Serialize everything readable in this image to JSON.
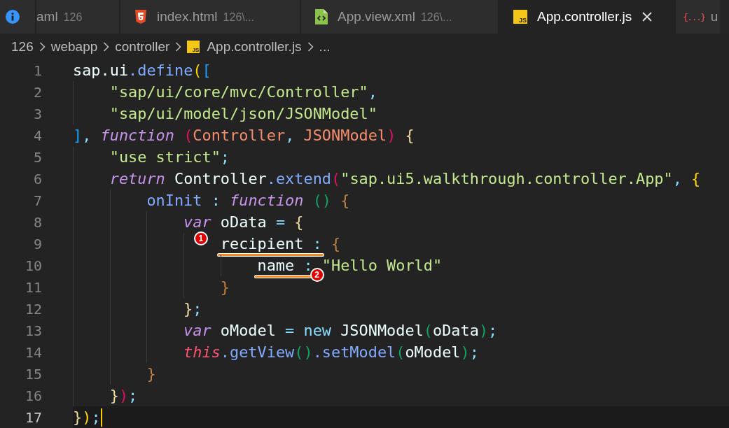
{
  "tabs": [
    {
      "kind": "info",
      "selected": false
    },
    {
      "label": "aml",
      "detail": "126",
      "selected": false
    },
    {
      "kind": "html",
      "label": "index.html",
      "detail": "126\\...",
      "selected": false
    },
    {
      "kind": "xml",
      "label": "App.view.xml",
      "detail": "126\\...",
      "selected": false
    },
    {
      "kind": "js",
      "icon_text": "JS",
      "label": "App.controller.js",
      "selected": true
    },
    {
      "kind": "json",
      "icon_text": "{...}",
      "label": "u",
      "selected": false
    }
  ],
  "breadcrumb": [
    {
      "label": "126"
    },
    {
      "label": "webapp"
    },
    {
      "label": "controller"
    },
    {
      "kind": "js",
      "icon_text": "JS",
      "label": "App.controller.js"
    },
    {
      "label": "..."
    }
  ],
  "lines": [
    {
      "number": "1",
      "current": false,
      "tokens": [
        {
          "text": "sap.ui",
          "kind": "id"
        },
        {
          "text": ".define",
          "kind": "prop"
        },
        {
          "text": "(",
          "kind": "bk-gold"
        },
        {
          "text": "[",
          "kind": "bk-blue"
        }
      ]
    },
    {
      "number": "2",
      "current": false,
      "tokens": [
        {
          "text": "    \"sap/ui/core/mvc/Controller\"",
          "kind": "str"
        },
        {
          "text": ",",
          "kind": "punct"
        }
      ]
    },
    {
      "number": "3",
      "current": false,
      "tokens": [
        {
          "text": "    \"sap/ui/model/json/JSONModel\"",
          "kind": "str"
        }
      ]
    },
    {
      "number": "4",
      "current": false,
      "tokens": [
        {
          "text": "]",
          "kind": "bk-blue"
        },
        {
          "text": ", ",
          "kind": "punct"
        },
        {
          "text": "function",
          "kind": "kw"
        },
        {
          "text": " (",
          "kind": "bk-pink"
        },
        {
          "text": "Controller",
          "kind": "param"
        },
        {
          "text": ", ",
          "kind": "punct"
        },
        {
          "text": "JSONModel",
          "kind": "param"
        },
        {
          "text": ")",
          "kind": "bk-pink"
        },
        {
          "text": " {",
          "kind": "bk-pale"
        }
      ]
    },
    {
      "number": "5",
      "current": false,
      "tokens": [
        {
          "text": "    \"use strict\"",
          "kind": "str"
        },
        {
          "text": ";",
          "kind": "punct"
        }
      ]
    },
    {
      "number": "6",
      "current": false,
      "tokens": [
        {
          "text": "    return",
          "kind": "kw"
        },
        {
          "text": " Controller",
          "kind": "id"
        },
        {
          "text": ".extend",
          "kind": "prop"
        },
        {
          "text": "(",
          "kind": "bk-pink"
        },
        {
          "text": "\"sap.ui5.walkthrough.controller.App\"",
          "kind": "str"
        },
        {
          "text": ", ",
          "kind": "punct"
        },
        {
          "text": "{",
          "kind": "bk-gold"
        }
      ]
    },
    {
      "number": "7",
      "current": false,
      "tokens": [
        {
          "text": "        onInit",
          "kind": "prop"
        },
        {
          "text": " : ",
          "kind": "punct"
        },
        {
          "text": "function",
          "kind": "kw"
        },
        {
          "text": " ()",
          "kind": "bk-green"
        },
        {
          "text": " {",
          "kind": "bk-brown"
        }
      ]
    },
    {
      "number": "8",
      "current": false,
      "tokens": [
        {
          "text": "            var",
          "kind": "kw"
        },
        {
          "text": " oData",
          "kind": "id"
        },
        {
          "text": " = ",
          "kind": "punct"
        },
        {
          "text": "{",
          "kind": "bk-pale"
        }
      ]
    },
    {
      "number": "9",
      "current": false,
      "badge": "1",
      "tokens": [
        {
          "text": "                recipient",
          "kind": "id",
          "marked": true
        },
        {
          "text": " :",
          "kind": "punct",
          "marked": true
        },
        {
          "text": " {",
          "kind": "bk-brown"
        }
      ]
    },
    {
      "number": "10",
      "current": false,
      "badge": "2",
      "tokens": [
        {
          "text": "                    name",
          "kind": "id",
          "marked": true
        },
        {
          "text": " :",
          "kind": "punct",
          "marked": true
        },
        {
          "text": " \"Hello World\"",
          "kind": "str"
        }
      ]
    },
    {
      "number": "11",
      "current": false,
      "tokens": [
        {
          "text": "                }",
          "kind": "bk-brown"
        }
      ]
    },
    {
      "number": "12",
      "current": false,
      "tokens": [
        {
          "text": "            }",
          "kind": "bk-pale"
        },
        {
          "text": ";",
          "kind": "punct"
        }
      ]
    },
    {
      "number": "13",
      "current": false,
      "tokens": [
        {
          "text": "            var",
          "kind": "kw"
        },
        {
          "text": " oModel",
          "kind": "id"
        },
        {
          "text": " = ",
          "kind": "punct"
        },
        {
          "text": "new",
          "kind": "punct"
        },
        {
          "text": " JSONModel",
          "kind": "id"
        },
        {
          "text": "(",
          "kind": "bk-green"
        },
        {
          "text": "oData",
          "kind": "id"
        },
        {
          "text": ")",
          "kind": "bk-green"
        },
        {
          "text": ";",
          "kind": "punct"
        }
      ]
    },
    {
      "number": "14",
      "current": false,
      "tokens": [
        {
          "text": "            this",
          "kind": "this"
        },
        {
          "text": ".getView",
          "kind": "prop"
        },
        {
          "text": "()",
          "kind": "bk-green"
        },
        {
          "text": ".setModel",
          "kind": "prop"
        },
        {
          "text": "(",
          "kind": "bk-green"
        },
        {
          "text": "oModel",
          "kind": "id"
        },
        {
          "text": ")",
          "kind": "bk-green"
        },
        {
          "text": ";",
          "kind": "punct"
        }
      ]
    },
    {
      "number": "15",
      "current": false,
      "tokens": [
        {
          "text": "        }",
          "kind": "bk-brown"
        }
      ]
    },
    {
      "number": "16",
      "current": false,
      "tokens": [
        {
          "text": "    }",
          "kind": "bk-pale"
        },
        {
          "text": ")",
          "kind": "bk-pink"
        },
        {
          "text": ";",
          "kind": "punct"
        }
      ]
    },
    {
      "number": "17",
      "current": true,
      "tokens": [
        {
          "text": "}",
          "kind": "bk-pale"
        },
        {
          "text": ")",
          "kind": "bk-gold"
        },
        {
          "text": ";",
          "kind": "punct"
        }
      ]
    }
  ]
}
